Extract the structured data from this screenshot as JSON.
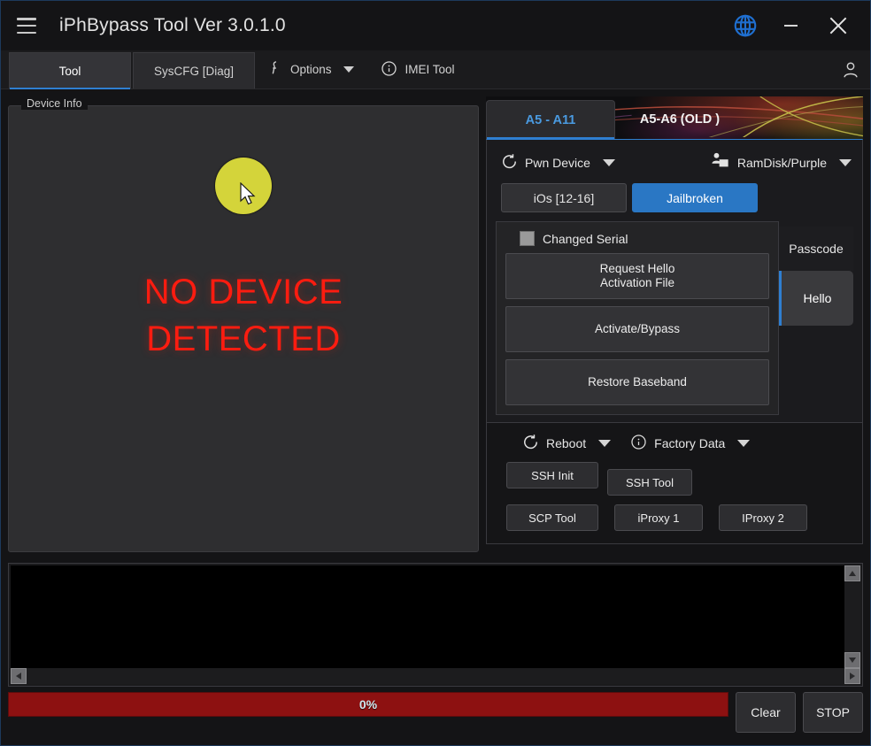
{
  "window": {
    "title": "iPhBypass Tool  Ver 3.0.1.0",
    "menu_icon": "hamburger-icon",
    "globe_icon": "globe-icon",
    "minimize_label": "–",
    "close_label": "✕"
  },
  "menubar": {
    "tabs": [
      {
        "label": "Tool",
        "active": true
      },
      {
        "label": "SysCFG [Diag]",
        "active": false
      }
    ],
    "items": [
      {
        "label": "Options",
        "icon": "wrench-icon",
        "has_caret": true
      },
      {
        "label": "IMEI Tool",
        "icon": "info-circle-icon",
        "has_caret": false
      }
    ],
    "account_icon": "user-icon"
  },
  "device_info": {
    "group_title": "Device Info",
    "status_color": "#d4d43a",
    "status_icon": "status-circle",
    "message_line1": "NO DEVICE",
    "message_line2": "DETECTED",
    "message_color": "#fc1c10",
    "cursor_icon": "mouse-cursor"
  },
  "chip_tabs": [
    {
      "label": "A5 - A11",
      "active": true
    },
    {
      "label": "A5-A6 (OLD )",
      "active": false
    }
  ],
  "chip_panel": {
    "dropdowns": [
      {
        "label": "Pwn Device",
        "icon": "refresh-icon"
      },
      {
        "label": "RamDisk/Purple",
        "icon": "ramdisk-icon"
      }
    ],
    "toggles": [
      {
        "label": "iOs [12-16]",
        "active": false
      },
      {
        "label": "Jailbroken",
        "active": true
      }
    ],
    "checkbox": {
      "label": "Changed Serial",
      "checked": false
    },
    "actions": [
      {
        "line1": "Request Hello",
        "line2": "Activation File"
      },
      {
        "line1": "Activate/Bypass",
        "line2": ""
      },
      {
        "line1": "Restore Baseband",
        "line2": ""
      }
    ],
    "vtabs": [
      {
        "label": "Passcode",
        "active": false
      },
      {
        "label": "Hello",
        "active": true
      }
    ]
  },
  "tools_panel": {
    "dropdowns": [
      {
        "label": "Reboot",
        "icon": "refresh-icon"
      },
      {
        "label": "Factory Data",
        "icon": "info-circle-icon"
      }
    ],
    "buttons_row1": [
      {
        "label": "SSH Init"
      },
      {
        "label": "SSH Tool"
      }
    ],
    "buttons_row2": [
      {
        "label": "SCP Tool"
      },
      {
        "label": "iProxy 1"
      },
      {
        "label": "IProxy 2"
      }
    ]
  },
  "console": {
    "text": "",
    "scroll_up": "scroll-up-icon",
    "scroll_down": "scroll-down-icon",
    "scroll_left": "scroll-left-icon",
    "scroll_right": "scroll-right-icon"
  },
  "footer": {
    "progress_value": "0%",
    "progress_color": "#8d1111",
    "clear_label": "Clear",
    "stop_label": "STOP"
  }
}
